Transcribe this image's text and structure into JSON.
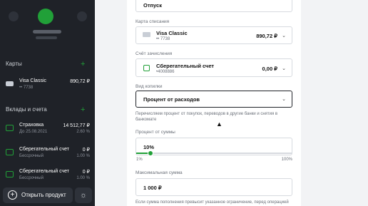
{
  "sidebar": {
    "cards_title": "Карты",
    "cards": [
      {
        "name": "Visa Classic",
        "sub": "•• 7738",
        "amount": "890,72 ₽"
      }
    ],
    "deposits_title": "Вклады и счета",
    "deposits": [
      {
        "name": "Страховка",
        "sub": "До 25.08.2021",
        "amount": "14 512,77 ₽",
        "pct": "2.60 %"
      },
      {
        "name": "Сберегательный счет",
        "sub": "Бессрочный",
        "amount": "0 ₽",
        "pct": "1.00 %"
      },
      {
        "name": "Сберегательный счет",
        "sub": "Бессрочный",
        "amount": "0 ₽",
        "pct": "1.00 %"
      }
    ],
    "open_product": "Открыть продукт"
  },
  "form": {
    "goal_value": "Отпуск",
    "debit_label": "Карта списания",
    "debit_name": "Visa Classic",
    "debit_sub": "•• 7738",
    "debit_amount": "890,72 ₽",
    "credit_label": "Счёт зачисления",
    "credit_name": "Сберегательный счет",
    "credit_sub": "•4008886",
    "credit_amount": "0,00 ₽",
    "type_label": "Вид копилки",
    "type_value": "Процент от расходов",
    "type_hint": "Перечисляем процент от покупок, переводов в другие банки и снятия в банкомате",
    "percent_label": "Процент от суммы",
    "percent_value": "10%",
    "percent_level": 0.09,
    "slider_min": "1%",
    "slider_max": "100%",
    "max_label": "Максимальная сумма",
    "max_value": "1 000 ₽",
    "max_hint": "Если сумма пополнения превысит указанное ограничение, перед операцией"
  },
  "colors": {
    "accent": "#21a038",
    "sidebar_bg": "#1f2228"
  }
}
